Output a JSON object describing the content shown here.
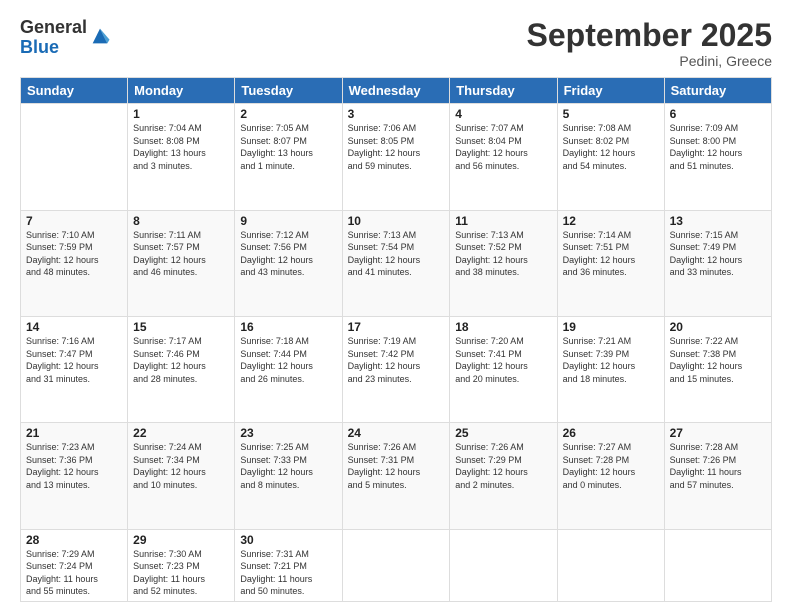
{
  "header": {
    "logo_general": "General",
    "logo_blue": "Blue",
    "month_title": "September 2025",
    "location": "Pedini, Greece"
  },
  "days_of_week": [
    "Sunday",
    "Monday",
    "Tuesday",
    "Wednesday",
    "Thursday",
    "Friday",
    "Saturday"
  ],
  "weeks": [
    [
      {
        "day": "",
        "info": ""
      },
      {
        "day": "1",
        "info": "Sunrise: 7:04 AM\nSunset: 8:08 PM\nDaylight: 13 hours\nand 3 minutes."
      },
      {
        "day": "2",
        "info": "Sunrise: 7:05 AM\nSunset: 8:07 PM\nDaylight: 13 hours\nand 1 minute."
      },
      {
        "day": "3",
        "info": "Sunrise: 7:06 AM\nSunset: 8:05 PM\nDaylight: 12 hours\nand 59 minutes."
      },
      {
        "day": "4",
        "info": "Sunrise: 7:07 AM\nSunset: 8:04 PM\nDaylight: 12 hours\nand 56 minutes."
      },
      {
        "day": "5",
        "info": "Sunrise: 7:08 AM\nSunset: 8:02 PM\nDaylight: 12 hours\nand 54 minutes."
      },
      {
        "day": "6",
        "info": "Sunrise: 7:09 AM\nSunset: 8:00 PM\nDaylight: 12 hours\nand 51 minutes."
      }
    ],
    [
      {
        "day": "7",
        "info": "Sunrise: 7:10 AM\nSunset: 7:59 PM\nDaylight: 12 hours\nand 48 minutes."
      },
      {
        "day": "8",
        "info": "Sunrise: 7:11 AM\nSunset: 7:57 PM\nDaylight: 12 hours\nand 46 minutes."
      },
      {
        "day": "9",
        "info": "Sunrise: 7:12 AM\nSunset: 7:56 PM\nDaylight: 12 hours\nand 43 minutes."
      },
      {
        "day": "10",
        "info": "Sunrise: 7:13 AM\nSunset: 7:54 PM\nDaylight: 12 hours\nand 41 minutes."
      },
      {
        "day": "11",
        "info": "Sunrise: 7:13 AM\nSunset: 7:52 PM\nDaylight: 12 hours\nand 38 minutes."
      },
      {
        "day": "12",
        "info": "Sunrise: 7:14 AM\nSunset: 7:51 PM\nDaylight: 12 hours\nand 36 minutes."
      },
      {
        "day": "13",
        "info": "Sunrise: 7:15 AM\nSunset: 7:49 PM\nDaylight: 12 hours\nand 33 minutes."
      }
    ],
    [
      {
        "day": "14",
        "info": "Sunrise: 7:16 AM\nSunset: 7:47 PM\nDaylight: 12 hours\nand 31 minutes."
      },
      {
        "day": "15",
        "info": "Sunrise: 7:17 AM\nSunset: 7:46 PM\nDaylight: 12 hours\nand 28 minutes."
      },
      {
        "day": "16",
        "info": "Sunrise: 7:18 AM\nSunset: 7:44 PM\nDaylight: 12 hours\nand 26 minutes."
      },
      {
        "day": "17",
        "info": "Sunrise: 7:19 AM\nSunset: 7:42 PM\nDaylight: 12 hours\nand 23 minutes."
      },
      {
        "day": "18",
        "info": "Sunrise: 7:20 AM\nSunset: 7:41 PM\nDaylight: 12 hours\nand 20 minutes."
      },
      {
        "day": "19",
        "info": "Sunrise: 7:21 AM\nSunset: 7:39 PM\nDaylight: 12 hours\nand 18 minutes."
      },
      {
        "day": "20",
        "info": "Sunrise: 7:22 AM\nSunset: 7:38 PM\nDaylight: 12 hours\nand 15 minutes."
      }
    ],
    [
      {
        "day": "21",
        "info": "Sunrise: 7:23 AM\nSunset: 7:36 PM\nDaylight: 12 hours\nand 13 minutes."
      },
      {
        "day": "22",
        "info": "Sunrise: 7:24 AM\nSunset: 7:34 PM\nDaylight: 12 hours\nand 10 minutes."
      },
      {
        "day": "23",
        "info": "Sunrise: 7:25 AM\nSunset: 7:33 PM\nDaylight: 12 hours\nand 8 minutes."
      },
      {
        "day": "24",
        "info": "Sunrise: 7:26 AM\nSunset: 7:31 PM\nDaylight: 12 hours\nand 5 minutes."
      },
      {
        "day": "25",
        "info": "Sunrise: 7:26 AM\nSunset: 7:29 PM\nDaylight: 12 hours\nand 2 minutes."
      },
      {
        "day": "26",
        "info": "Sunrise: 7:27 AM\nSunset: 7:28 PM\nDaylight: 12 hours\nand 0 minutes."
      },
      {
        "day": "27",
        "info": "Sunrise: 7:28 AM\nSunset: 7:26 PM\nDaylight: 11 hours\nand 57 minutes."
      }
    ],
    [
      {
        "day": "28",
        "info": "Sunrise: 7:29 AM\nSunset: 7:24 PM\nDaylight: 11 hours\nand 55 minutes."
      },
      {
        "day": "29",
        "info": "Sunrise: 7:30 AM\nSunset: 7:23 PM\nDaylight: 11 hours\nand 52 minutes."
      },
      {
        "day": "30",
        "info": "Sunrise: 7:31 AM\nSunset: 7:21 PM\nDaylight: 11 hours\nand 50 minutes."
      },
      {
        "day": "",
        "info": ""
      },
      {
        "day": "",
        "info": ""
      },
      {
        "day": "",
        "info": ""
      },
      {
        "day": "",
        "info": ""
      }
    ]
  ]
}
